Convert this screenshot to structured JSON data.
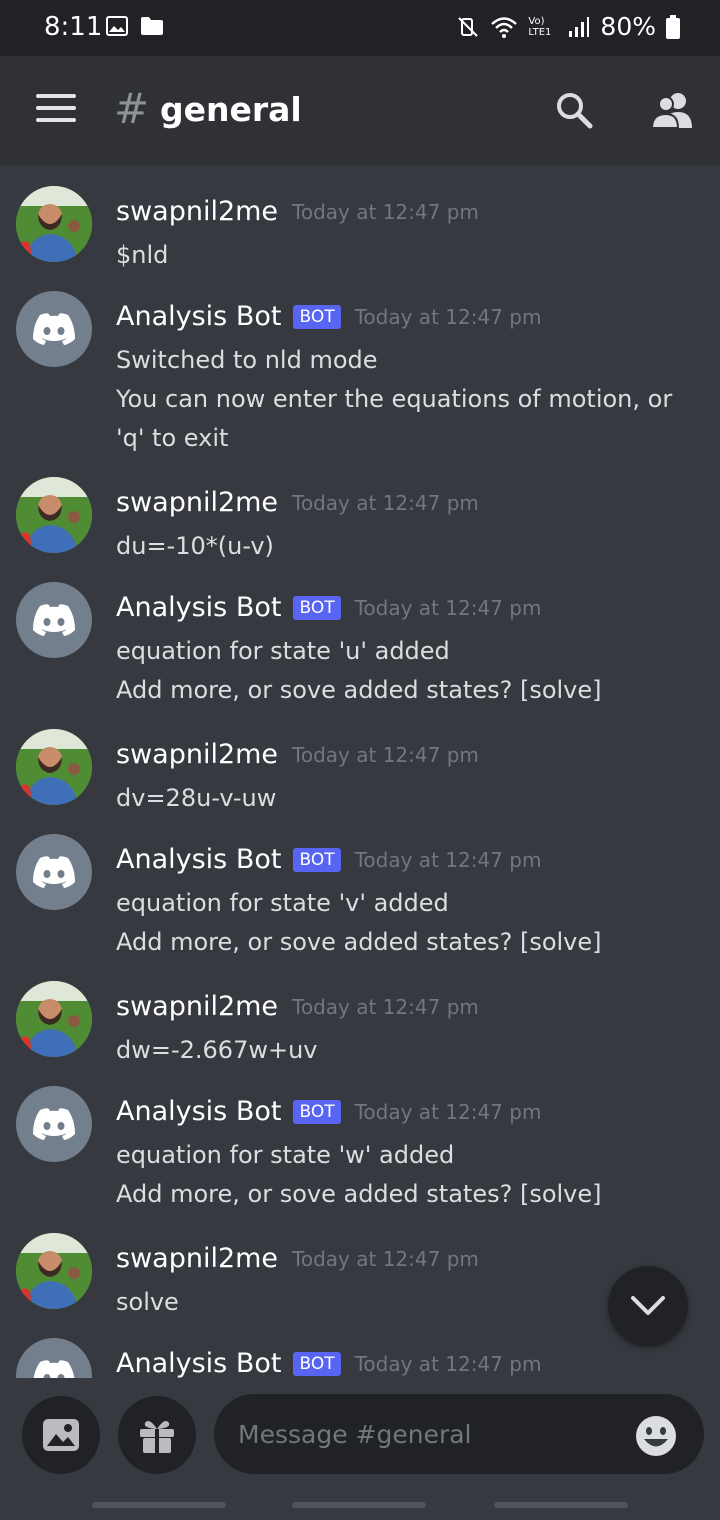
{
  "status_bar": {
    "time": "8:11",
    "lte_label": "Vo) LTE1",
    "battery": "80%"
  },
  "header": {
    "hash": "#",
    "channel": "general"
  },
  "messages": [
    {
      "author": "swapnil2me",
      "is_bot": false,
      "bot_tag": "",
      "timestamp": "Today at 12:47 pm",
      "lines": [
        "$nld"
      ]
    },
    {
      "author": "Analysis Bot",
      "is_bot": true,
      "bot_tag": "BOT",
      "timestamp": "Today at 12:47 pm",
      "lines": [
        "Switched to nld mode",
        "You can now enter the equations of motion, or 'q' to exit"
      ]
    },
    {
      "author": "swapnil2me",
      "is_bot": false,
      "bot_tag": "",
      "timestamp": "Today at 12:47 pm",
      "lines": [
        "du=-10*(u-v)"
      ]
    },
    {
      "author": "Analysis Bot",
      "is_bot": true,
      "bot_tag": "BOT",
      "timestamp": "Today at 12:47 pm",
      "lines": [
        "equation for state 'u' added",
        "Add more, or sove added states? [solve]"
      ]
    },
    {
      "author": "swapnil2me",
      "is_bot": false,
      "bot_tag": "",
      "timestamp": "Today at 12:47 pm",
      "lines": [
        "dv=28u-v-uw"
      ]
    },
    {
      "author": "Analysis Bot",
      "is_bot": true,
      "bot_tag": "BOT",
      "timestamp": "Today at 12:47 pm",
      "lines": [
        "equation for state 'v' added",
        "Add more, or sove added states? [solve]"
      ]
    },
    {
      "author": "swapnil2me",
      "is_bot": false,
      "bot_tag": "",
      "timestamp": "Today at 12:47 pm",
      "lines": [
        "dw=-2.667w+uv"
      ]
    },
    {
      "author": "Analysis Bot",
      "is_bot": true,
      "bot_tag": "BOT",
      "timestamp": "Today at 12:47 pm",
      "lines": [
        "equation for state 'w' added",
        "Add more, or sove added states? [solve]"
      ]
    },
    {
      "author": "swapnil2me",
      "is_bot": false,
      "bot_tag": "",
      "timestamp": "Today at 12:47 pm",
      "lines": [
        "solve"
      ]
    },
    {
      "author": "Analysis Bot",
      "is_bot": true,
      "bot_tag": "BOT",
      "timestamp": "Today at 12:47 pm",
      "lines": []
    }
  ],
  "composer": {
    "placeholder": "Message #general",
    "value": ""
  },
  "icons": {
    "menu": "hamburger-icon",
    "search": "search-icon",
    "members": "members-icon",
    "jump": "chevron-down-icon",
    "image": "image-icon",
    "gift": "gift-icon",
    "emoji": "emoji-icon",
    "bot_avatar": "discord-logo-icon"
  },
  "colors": {
    "background": "#36393f",
    "header": "#2f3136",
    "bot_tag": "#5865f2",
    "timestamp": "#72767d"
  }
}
